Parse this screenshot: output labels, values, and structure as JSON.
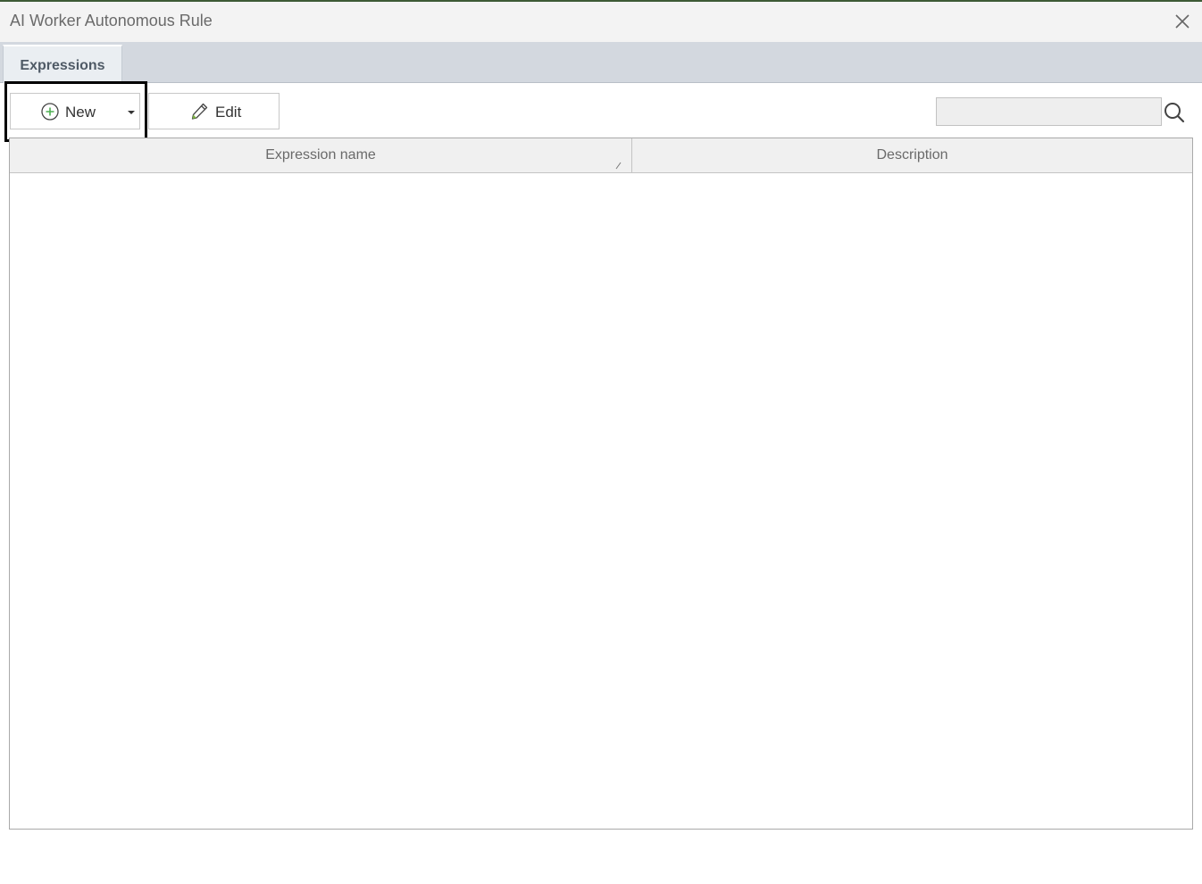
{
  "window": {
    "title": "AI Worker Autonomous Rule",
    "close_icon": "close-icon",
    "accent_color": "#3d5a36"
  },
  "tabs": [
    {
      "label": "Expressions",
      "selected": true
    }
  ],
  "toolbar": {
    "new_label": "New",
    "new_icon": "plus-circle-icon",
    "new_has_dropdown": true,
    "edit_label": "Edit",
    "edit_icon": "pencil-icon"
  },
  "search": {
    "value": "",
    "placeholder": "",
    "icon": "search-icon"
  },
  "grid": {
    "columns": [
      {
        "label": "Expression name",
        "sort_icon": "sort-indicator-icon"
      },
      {
        "label": "Description"
      }
    ],
    "rows": []
  }
}
